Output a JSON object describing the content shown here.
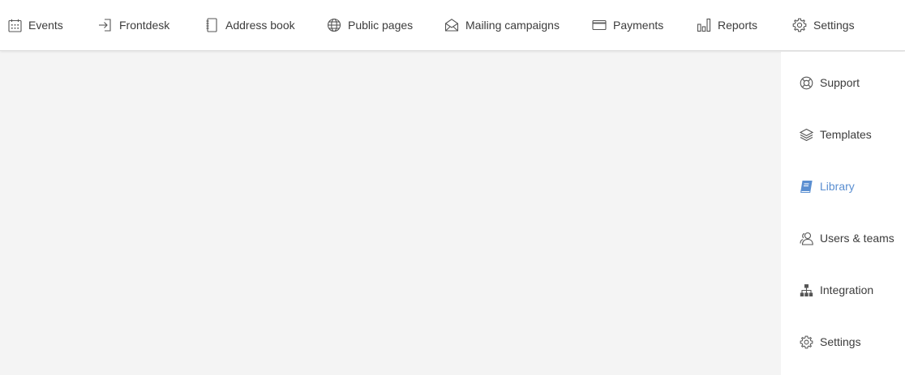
{
  "nav": {
    "items": [
      {
        "label": "Events",
        "icon": "calendar-icon"
      },
      {
        "label": "Frontdesk",
        "icon": "sign-in-icon"
      },
      {
        "label": "Address book",
        "icon": "address-book-icon"
      },
      {
        "label": "Public pages",
        "icon": "globe-icon"
      },
      {
        "label": "Mailing campaigns",
        "icon": "envelope-open-icon"
      },
      {
        "label": "Payments",
        "icon": "credit-card-icon"
      },
      {
        "label": "Reports",
        "icon": "bar-chart-icon"
      },
      {
        "label": "Settings",
        "icon": "gear-icon"
      }
    ]
  },
  "settings_menu": {
    "items": [
      {
        "label": "Support",
        "icon": "life-ring-icon"
      },
      {
        "label": "Templates",
        "icon": "layers-icon"
      },
      {
        "label": "Library",
        "icon": "book-icon",
        "active": true
      },
      {
        "label": "Users & teams",
        "icon": "users-icon"
      },
      {
        "label": "Integration",
        "icon": "sitemap-icon"
      },
      {
        "label": "Settings",
        "icon": "gear-icon"
      }
    ]
  },
  "colors": {
    "active": "#5b8fd1",
    "text": "#3c3c3c",
    "background": "#f4f4f4"
  }
}
